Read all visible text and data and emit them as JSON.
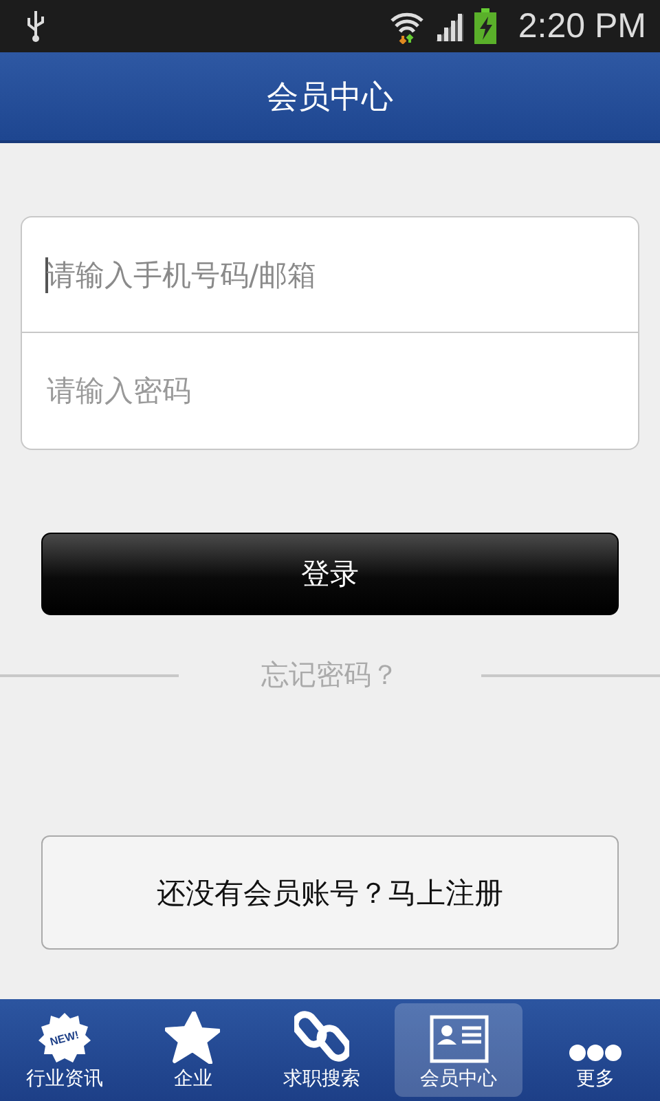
{
  "status_bar": {
    "time": "2:20 PM"
  },
  "header": {
    "title": "会员中心"
  },
  "form": {
    "fields": [
      {
        "placeholder": "请输入手机号码/邮箱",
        "focused": true
      },
      {
        "placeholder": "请输入密码",
        "focused": false
      }
    ]
  },
  "login_button": "登录",
  "forgot_link": "忘记密码？",
  "register_button": "还没有会员账号？马上注册",
  "tabs": [
    {
      "label": "行业资讯",
      "kind": "new",
      "badge": "NEW!",
      "selected": false
    },
    {
      "label": "企业",
      "kind": "star",
      "selected": false
    },
    {
      "label": "求职搜索",
      "kind": "link",
      "selected": false
    },
    {
      "label": "会员中心",
      "kind": "card",
      "selected": true
    },
    {
      "label": "更多",
      "kind": "more",
      "selected": false
    }
  ]
}
